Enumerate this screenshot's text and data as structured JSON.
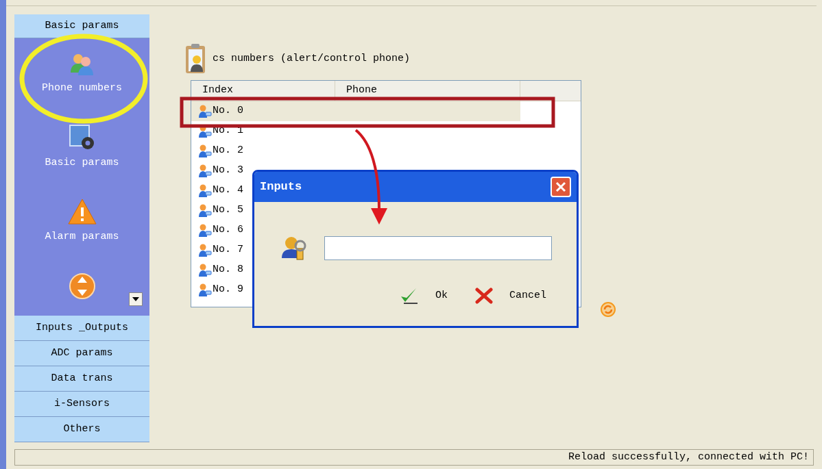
{
  "sidebar": {
    "header": "Basic params",
    "items": [
      {
        "label": "Phone numbers",
        "kind": "people"
      },
      {
        "label": "Basic params",
        "kind": "gear"
      },
      {
        "label": "Alarm params",
        "kind": "warning"
      },
      {
        "kind": "arrows"
      }
    ],
    "sections": [
      "Inputs _Outputs",
      "ADC params",
      "Data trans",
      "i-Sensors",
      "Others"
    ]
  },
  "main": {
    "title": "cs numbers (alert/control phone)",
    "table": {
      "columns": [
        "Index",
        "Phone"
      ],
      "rows": [
        {
          "index": "No. 0",
          "selected": true
        },
        {
          "index": "No. 1",
          "selected": false
        },
        {
          "index": "No. 2",
          "selected": false
        },
        {
          "index": "No. 3",
          "selected": false
        },
        {
          "index": "No. 4",
          "selected": false
        },
        {
          "index": "No. 5",
          "selected": false
        },
        {
          "index": "No. 6",
          "selected": false
        },
        {
          "index": "No. 7",
          "selected": false
        },
        {
          "index": "No. 8",
          "selected": false
        },
        {
          "index": "No. 9",
          "selected": false
        }
      ]
    }
  },
  "dialog": {
    "title": "Inputs",
    "buttons": [
      {
        "label": "Ok",
        "kind": "ok"
      },
      {
        "label": "Cancel",
        "kind": "cancel"
      }
    ]
  },
  "status_bar": "Reload successfully, connected with PC!"
}
